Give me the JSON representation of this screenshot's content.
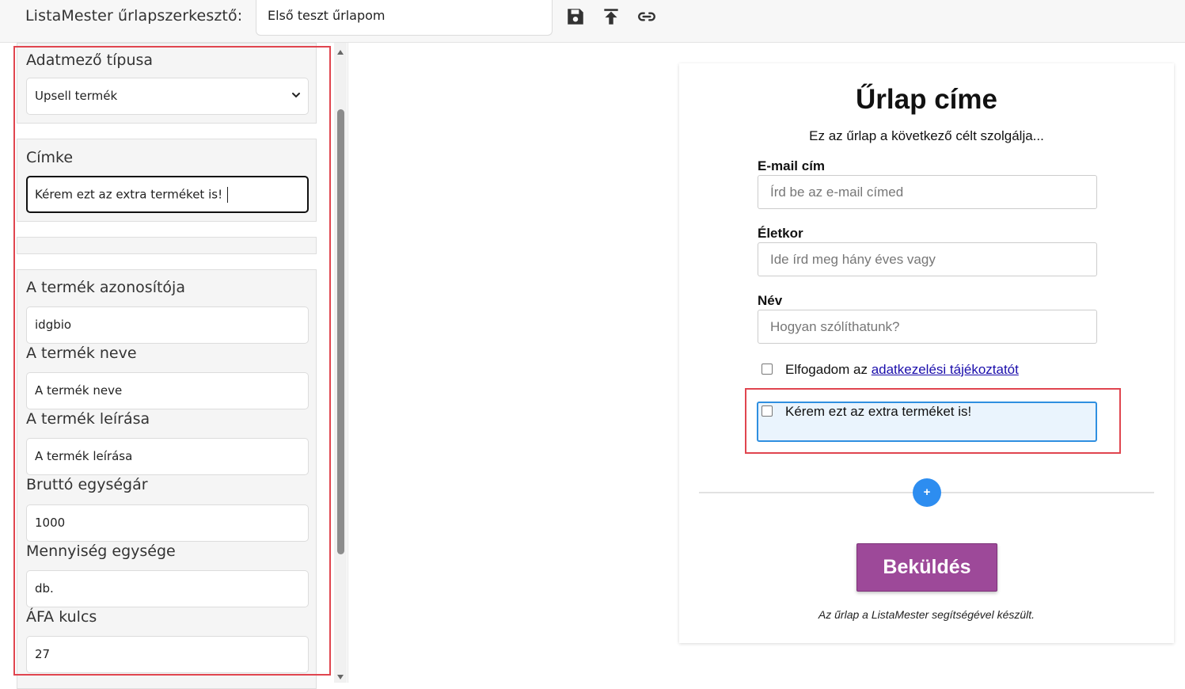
{
  "topbar": {
    "app_title": "ListaMester űrlapszerkesztő:",
    "form_name": "Első teszt űrlapom",
    "icons": [
      "save-icon",
      "publish-icon",
      "link-icon"
    ]
  },
  "editor": {
    "field_type_label": "Adatmező típusa",
    "field_type_value": "Upsell termék",
    "label_label": "Címke",
    "label_value": "Kérem ezt az extra terméket is!",
    "product_id_label": "A termék azonosítója",
    "product_id_value": "idgbio",
    "product_name_label": "A termék neve",
    "product_name_value": "A termék neve",
    "product_desc_label": "A termék leírása",
    "product_desc_value": "A termék leírása",
    "gross_price_label": "Bruttó egységár",
    "gross_price_value": "1000",
    "unit_label": "Mennyiség egysége",
    "unit_value": "db.",
    "vat_label": "ÁFA kulcs",
    "vat_value": "27"
  },
  "preview": {
    "title": "Űrlap címe",
    "subtitle": "Ez az űrlap a következő célt szolgálja...",
    "email_label": "E-mail cím",
    "email_placeholder": "Írd be az e-mail címed",
    "age_label": "Életkor",
    "age_placeholder": "Ide írd meg hány éves vagy",
    "name_label": "Név",
    "name_placeholder": "Hogyan szólíthatunk?",
    "privacy_prefix": "Elfogadom az ",
    "privacy_link": "adatkezelési tájékoztatót",
    "upsell_label": "Kérem ezt az extra terméket is!",
    "add_button": "+",
    "submit": "Beküldés",
    "footer": "Az űrlap a ListaMester segítségével készült."
  },
  "colors": {
    "highlight": "#e0454f",
    "submit": "#9d4999",
    "add_button": "#2d8df0",
    "link": "#1a0dab"
  }
}
